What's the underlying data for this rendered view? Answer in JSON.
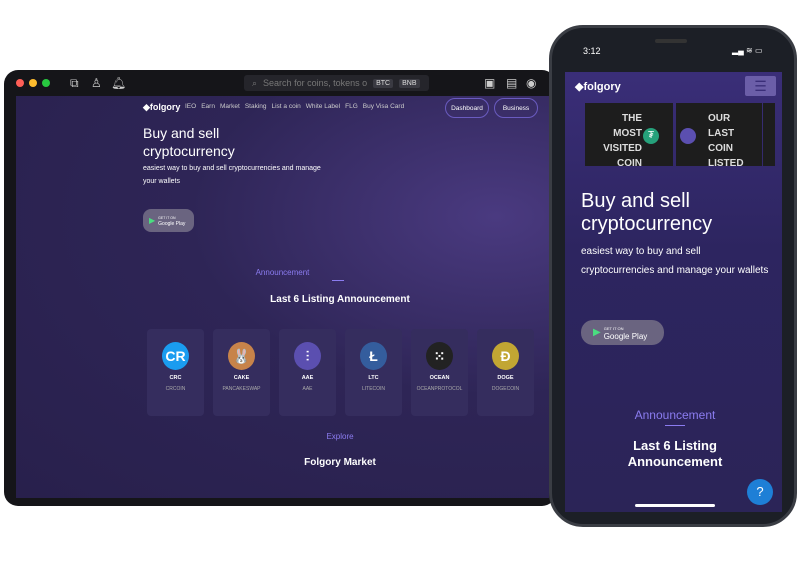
{
  "desktop": {
    "search_placeholder": "Search for coins, tokens o",
    "search_tags": [
      "BTC",
      "BNB"
    ],
    "logo": "folgory",
    "nav": [
      "IEO",
      "Earn",
      "Market",
      "Staking",
      "List a coin",
      "White Label",
      "FLG",
      "Buy Visa Card"
    ],
    "dashboard": "Dashboard",
    "business": "Business",
    "hero_title_1": "Buy and sell",
    "hero_title_2": "cryptocurrency",
    "hero_sub": "easiest way to buy and sell cryptocurrencies and manage your wallets",
    "gplay_small": "GET IT ON",
    "gplay": "Google Play",
    "announcement": "Announcement",
    "listing_title": "Last 6 Listing Announcement",
    "coins": [
      {
        "symbol": "CRC",
        "name": "CRCOIN",
        "color": "#1a9cf0",
        "glyph": "CR"
      },
      {
        "symbol": "CAKE",
        "name": "PANCAKESWAP",
        "color": "#c7834a",
        "glyph": "🐰"
      },
      {
        "symbol": "AAE",
        "name": "AAE",
        "color": "#5b4fb0",
        "glyph": "⫶"
      },
      {
        "symbol": "LTC",
        "name": "LITECOIN",
        "color": "#345d9d",
        "glyph": "Ł"
      },
      {
        "symbol": "OCEAN",
        "name": "OCEANPROTOCOL",
        "color": "#222",
        "glyph": "⁙"
      },
      {
        "symbol": "DOGE",
        "name": "DOGECOIN",
        "color": "#c2a633",
        "glyph": "Ð"
      }
    ],
    "explore": "Explore",
    "market_title": "Folgory Market"
  },
  "phone": {
    "time": "3:12",
    "logo": "folgory",
    "banner1": "THE MOST VISITED COIN",
    "banner2": "OUR LAST COIN LISTED",
    "hero_title": "Buy and sell cryptocurrency",
    "hero_sub": "easiest way to buy and sell cryptocurrencies and manage your wallets",
    "gplay_small": "GET IT ON",
    "gplay": "Google Play",
    "announcement": "Announcement",
    "listing_title": "Last 6 Listing Announcement",
    "help_icon": "?"
  }
}
